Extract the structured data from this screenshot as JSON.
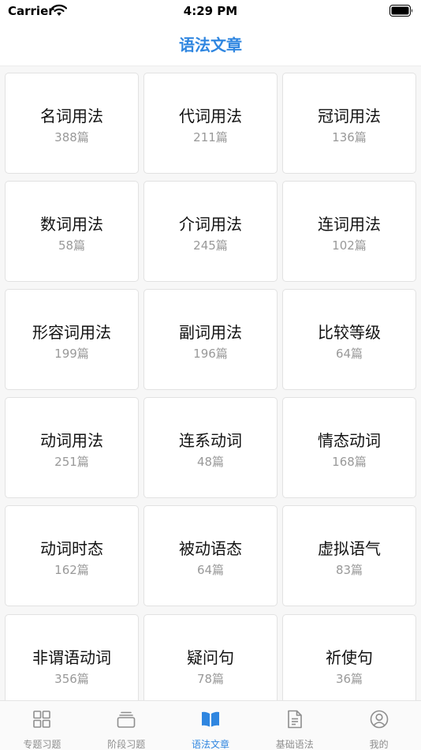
{
  "status": {
    "carrier": "Carrier",
    "time": "4:29 PM"
  },
  "nav": {
    "title": "语法文章"
  },
  "items": [
    {
      "title": "名词用法",
      "count": "388篇"
    },
    {
      "title": "代词用法",
      "count": "211篇"
    },
    {
      "title": "冠词用法",
      "count": "136篇"
    },
    {
      "title": "数词用法",
      "count": "58篇"
    },
    {
      "title": "介词用法",
      "count": "245篇"
    },
    {
      "title": "连词用法",
      "count": "102篇"
    },
    {
      "title": "形容词用法",
      "count": "199篇"
    },
    {
      "title": "副词用法",
      "count": "196篇"
    },
    {
      "title": "比较等级",
      "count": "64篇"
    },
    {
      "title": "动词用法",
      "count": "251篇"
    },
    {
      "title": "连系动词",
      "count": "48篇"
    },
    {
      "title": "情态动词",
      "count": "168篇"
    },
    {
      "title": "动词时态",
      "count": "162篇"
    },
    {
      "title": "被动语态",
      "count": "64篇"
    },
    {
      "title": "虚拟语气",
      "count": "83篇"
    },
    {
      "title": "非谓语动词",
      "count": "356篇"
    },
    {
      "title": "疑问句",
      "count": "78篇"
    },
    {
      "title": "祈使句",
      "count": "36篇"
    }
  ],
  "tabs": [
    {
      "label": "专题习题",
      "icon": "grid-icon",
      "active": false
    },
    {
      "label": "阶段习题",
      "icon": "layers-icon",
      "active": false
    },
    {
      "label": "语法文章",
      "icon": "book-icon",
      "active": true
    },
    {
      "label": "基础语法",
      "icon": "document-icon",
      "active": false
    },
    {
      "label": "我的",
      "icon": "profile-icon",
      "active": false
    }
  ],
  "colors": {
    "accent": "#2f86e0",
    "inactive": "#8e8e8e",
    "count_text": "#999999"
  }
}
